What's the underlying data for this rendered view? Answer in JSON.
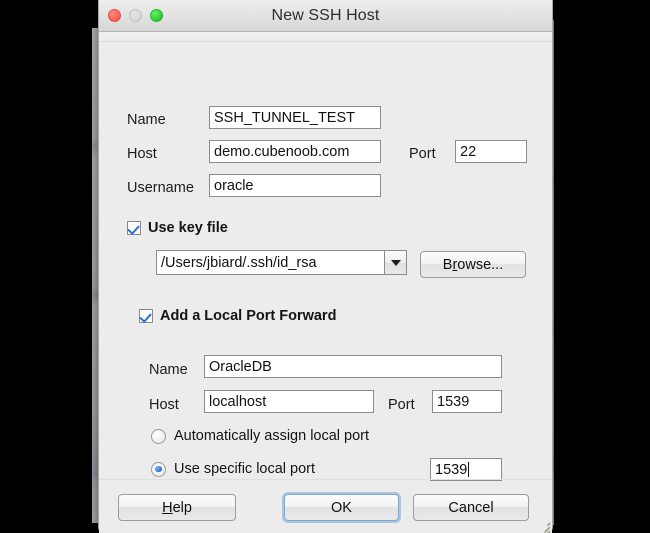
{
  "window": {
    "title": "New SSH Host",
    "controls": {
      "close": "close-button",
      "minimize": "minimize-button",
      "zoom": "zoom-button"
    }
  },
  "form": {
    "name_label": "Name",
    "name_value": "SSH_TUNNEL_TEST",
    "host_label": "Host",
    "host_value": "demo.cubenoob.com",
    "port_label": "Port",
    "port_value": "22",
    "username_label": "Username",
    "username_value": "oracle"
  },
  "keyfile": {
    "checkbox_label": "Use key file",
    "checked": true,
    "path_value": "/Users/jbiard/.ssh/id_rsa",
    "browse_label": "Browse...",
    "browse_mnemonic_before": "B",
    "browse_mnemonic": "r",
    "browse_mnemonic_after": "owse..."
  },
  "forward": {
    "checkbox_label": "Add a Local Port Forward",
    "checked": true,
    "name_label": "Name",
    "name_value": "OracleDB",
    "host_label": "Host",
    "host_value": "localhost",
    "port_label": "Port",
    "port_value": "1539",
    "auto_radio_label": "Automatically assign local port",
    "auto_selected": false,
    "specific_radio_label": "Use specific local port",
    "specific_selected": true,
    "specific_port_value": "1539"
  },
  "buttons": {
    "help_mnemonic": "H",
    "help_rest": "elp",
    "ok_label": "OK",
    "cancel_label": "Cancel"
  },
  "colors": {
    "accent_blue": "#2a72cf",
    "focus_ring": "#7aa8d4",
    "dialog_bg": "#ececec",
    "close_red": "#fc5d55",
    "zoom_green": "#25cc2a"
  }
}
